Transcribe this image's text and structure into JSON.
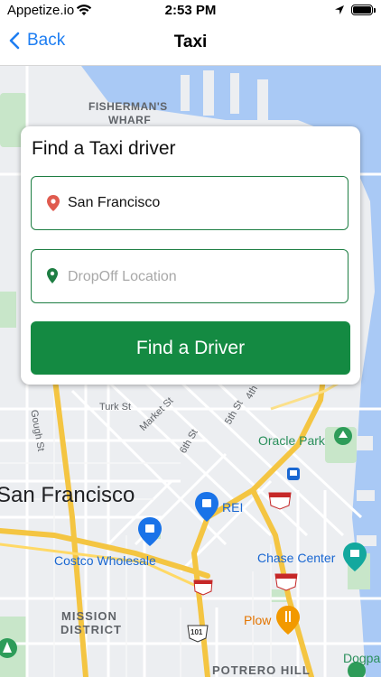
{
  "status_bar": {
    "carrier": "Appetize.io",
    "time": "2:53 PM"
  },
  "nav": {
    "back_label": "Back",
    "title": "Taxi"
  },
  "map": {
    "labels": {
      "fishermans_line1": "FISHERMAN'S",
      "fishermans_line2": "WHARF",
      "turk_st": "Turk St",
      "market_st": "Market St",
      "fourth_st": "4th St",
      "fifth_st": "5th St",
      "sixth_st": "6th St",
      "gough_st": "Gough St",
      "oracle_park": "Oracle Park",
      "san_francisco": "San Francisco",
      "rei": "REI",
      "costco": "Costco Wholesale",
      "chase_center": "Chase Center",
      "plow": "Plow",
      "mission_line1": "MISSION",
      "mission_line2": "DISTRICT",
      "potrero": "POTRERO HILL",
      "dogpa": "Dogpa",
      "shield_280_a": "280",
      "shield_280_b": "280",
      "shield_80": "80",
      "shield_101": "101"
    }
  },
  "card": {
    "title": "Find a Taxi driver",
    "pickup_value": "San Francisco",
    "dropoff_placeholder": "DropOff Location",
    "button_label": "Find a Driver"
  },
  "colors": {
    "accent": "#148a42",
    "link": "#1e7ef2",
    "water": "#a9c9f5",
    "park": "#c8e6c9"
  }
}
